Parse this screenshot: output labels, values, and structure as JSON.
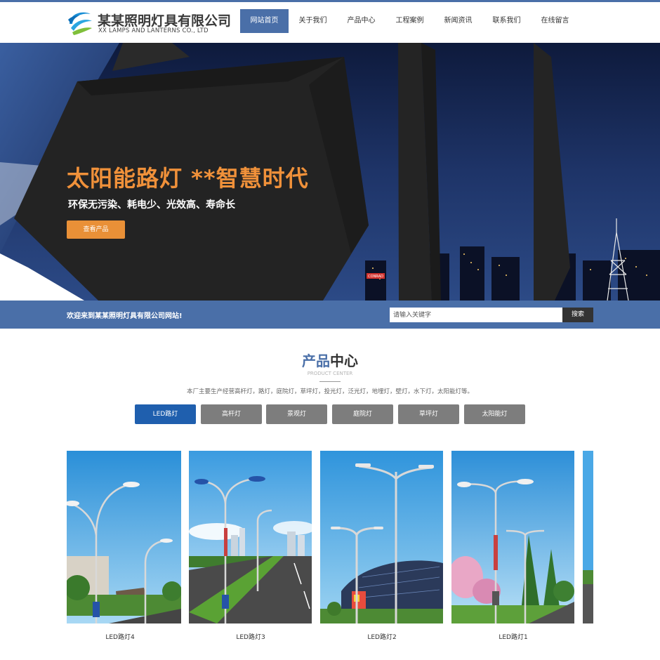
{
  "header": {
    "logo_cn": "某某照明灯具有限公司",
    "logo_en": "XX LAMPS AND LANTERNS CO., LTD",
    "nav": [
      {
        "label": "网站首页",
        "active": true
      },
      {
        "label": "关于我们"
      },
      {
        "label": "产品中心"
      },
      {
        "label": "工程案例"
      },
      {
        "label": "新闻资讯"
      },
      {
        "label": "联系我们"
      },
      {
        "label": "在线留言"
      }
    ]
  },
  "banner": {
    "title": "太阳能路灯 **智慧时代",
    "subtitle": "环保无污染、耗电少、光效高、寿命长",
    "button": "查看产品",
    "sign_text": "CONRAD"
  },
  "welcome_bar": {
    "text": "欢迎来到某某照明灯具有限公司网站!",
    "search_placeholder": "请输入关键字",
    "search_button": "搜索"
  },
  "products_section": {
    "title_part1": "产品",
    "title_part2": "中心",
    "subtitle_en": "PRODUCT CENTER",
    "description": "本厂主要生产经营高杆灯，路灯，庭院灯，草坪灯，投光灯，泛光灯，地埋灯，壁灯，水下灯，太阳能灯等。",
    "tabs": [
      {
        "label": "LED路灯",
        "active": true
      },
      {
        "label": "高杆灯"
      },
      {
        "label": "景观灯"
      },
      {
        "label": "庭院灯"
      },
      {
        "label": "草坪灯"
      },
      {
        "label": "太阳能灯"
      }
    ],
    "items": [
      {
        "label": "LED路灯4"
      },
      {
        "label": "LED路灯3"
      },
      {
        "label": "LED路灯2"
      },
      {
        "label": "LED路灯1"
      }
    ]
  },
  "colors": {
    "brand_blue": "#4a6fa8",
    "accent_orange": "#e99037",
    "tab_active": "#1f5fae",
    "tab_inactive": "#7d7d7d"
  }
}
